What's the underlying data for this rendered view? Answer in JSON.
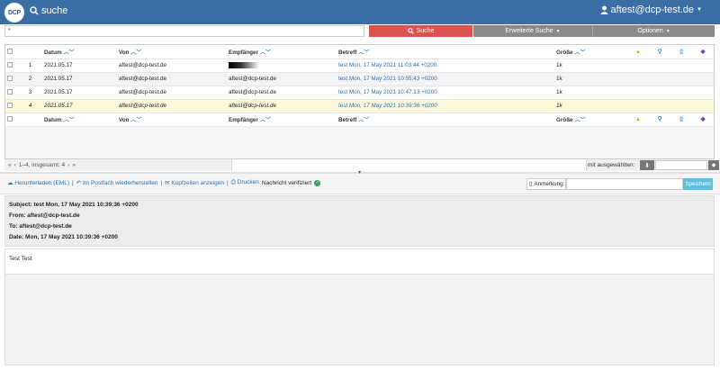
{
  "topbar": {
    "logo": "DCP",
    "search_label": "suche",
    "user": "aftest@dcp-test.de",
    "bg_color": "#3a6ea5"
  },
  "search": {
    "value": "*",
    "suche_button": "Suche",
    "erweitert_button": "Erweiterte Suche",
    "optionen_button": "Optionen"
  },
  "table": {
    "headers": {
      "datum": "Datum",
      "von": "Von",
      "empfaenger": "Empfänger",
      "betreff": "Betreff",
      "groesse": "Größe"
    },
    "rows": [
      {
        "num": "1",
        "datum": "2021.05.17",
        "von": "aftest@dcp-test.de",
        "empfaenger": "",
        "betreff": "test Mon, 17 May 2021 11:03:44 +0200",
        "groesse": "1k"
      },
      {
        "num": "2",
        "datum": "2021.05.17",
        "von": "aftest@dcp-test.de",
        "empfaenger": "aftest@dcp-test.de",
        "betreff": "test Mon, 17 May 2021 10:55:43 +0200",
        "groesse": "1k"
      },
      {
        "num": "3",
        "datum": "2021.05.17",
        "von": "aftest@dcp-test.de",
        "empfaenger": "aftest@dcp-test.de",
        "betreff": "test Mon, 17 May 2021 10:47:13 +0200",
        "groesse": "1k"
      },
      {
        "num": "4",
        "datum": "2021.05.17",
        "von": "aftest@dcp-test.de",
        "empfaenger": "aftest@dcp-test.de",
        "betreff": "test Mon, 17 May 2021 10:39:36 +0200",
        "groesse": "1k"
      }
    ]
  },
  "pager": {
    "text": "1–4, insgesamt: 4",
    "mit_label": "mit ausgewählten:"
  },
  "actions": {
    "download": "Herunterladen (EML)",
    "restore": "Im Postfach wiederherstellen",
    "headers": "Kopfzeilen anzeigen",
    "print": "Drucken",
    "verified": "Nachricht verifiziert",
    "annotation_label": "Anmerkung:",
    "save": "Speichern"
  },
  "message": {
    "subject": "Subject: test Mon, 17 May 2021 10:39:36 +0200",
    "from": "From: aftest@dcp-test.de",
    "to": "To: aftest@dcp-test.de",
    "date": "Date: Mon, 17 May 2021 10:39:36 +0200",
    "body": "Test Test"
  }
}
